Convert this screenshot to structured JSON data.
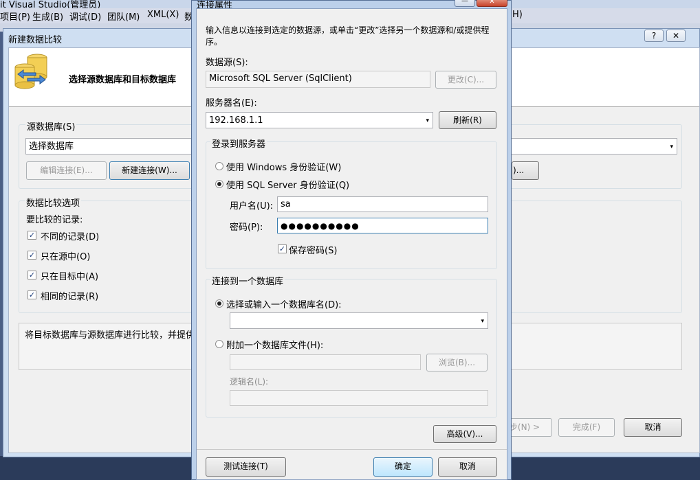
{
  "vs": {
    "title": "it Visual Studio(管理员)",
    "menus": [
      "项目(P)",
      "生成(B)",
      "调试(D)",
      "团队(M)",
      "XML(X)",
      "数",
      "H)"
    ]
  },
  "wizard": {
    "title": "新建数据比较",
    "help_glyph": "?",
    "close_glyph": "✕",
    "header_title": "选择源数据库和目标数据库",
    "source_group": "源数据库(S)",
    "source_combo": "选择数据库",
    "edit_conn": "编辑连接(E)...",
    "new_conn": "新建连接(W)...",
    "right_btn_fragment": ")...",
    "options_group": "数据比较选项",
    "records_label": "要比较的记录:",
    "checks": [
      "不同的记录(D)",
      "只在源中(O)",
      "只在目标中(A)",
      "相同的记录(R)"
    ],
    "check_glyph": "✓",
    "description": "将目标数据库与源数据库进行比较，并提供使",
    "next": "步(N) >",
    "finish": "完成(F)",
    "cancel": "取消"
  },
  "dialog": {
    "title": "连接属性",
    "intro": "输入信息以连接到选定的数据源，或单击“更改”选择另一个数据源和/或提供程序。",
    "datasource_label": "数据源(S):",
    "datasource_value": "Microsoft SQL Server (SqlClient)",
    "change_btn": "更改(C)...",
    "server_label": "服务器名(E):",
    "server_value": "192.168.1.1",
    "refresh_btn": "刷新(R)",
    "login_group": "登录到服务器",
    "windows_auth": "使用 Windows 身份验证(W)",
    "sql_auth": "使用 SQL Server 身份验证(Q)",
    "user_label": "用户名(U):",
    "user_value": "sa",
    "pwd_label": "密码(P):",
    "pwd_value": "●●●●●●●●●●",
    "save_pwd": "保存密码(S)",
    "db_group": "连接到一个数据库",
    "select_db": "选择或输入一个数据库名(D):",
    "db_value": "",
    "attach_db": "附加一个数据库文件(H):",
    "browse_btn": "浏览(B)...",
    "logical_label": "逻辑名(L):",
    "advanced_btn": "高级(V)...",
    "test_btn": "测试连接(T)",
    "ok_btn": "确定",
    "cancel_btn": "取消",
    "min_glyph": "—",
    "close_glyph": "✕",
    "arrow_glyph": "▾"
  }
}
